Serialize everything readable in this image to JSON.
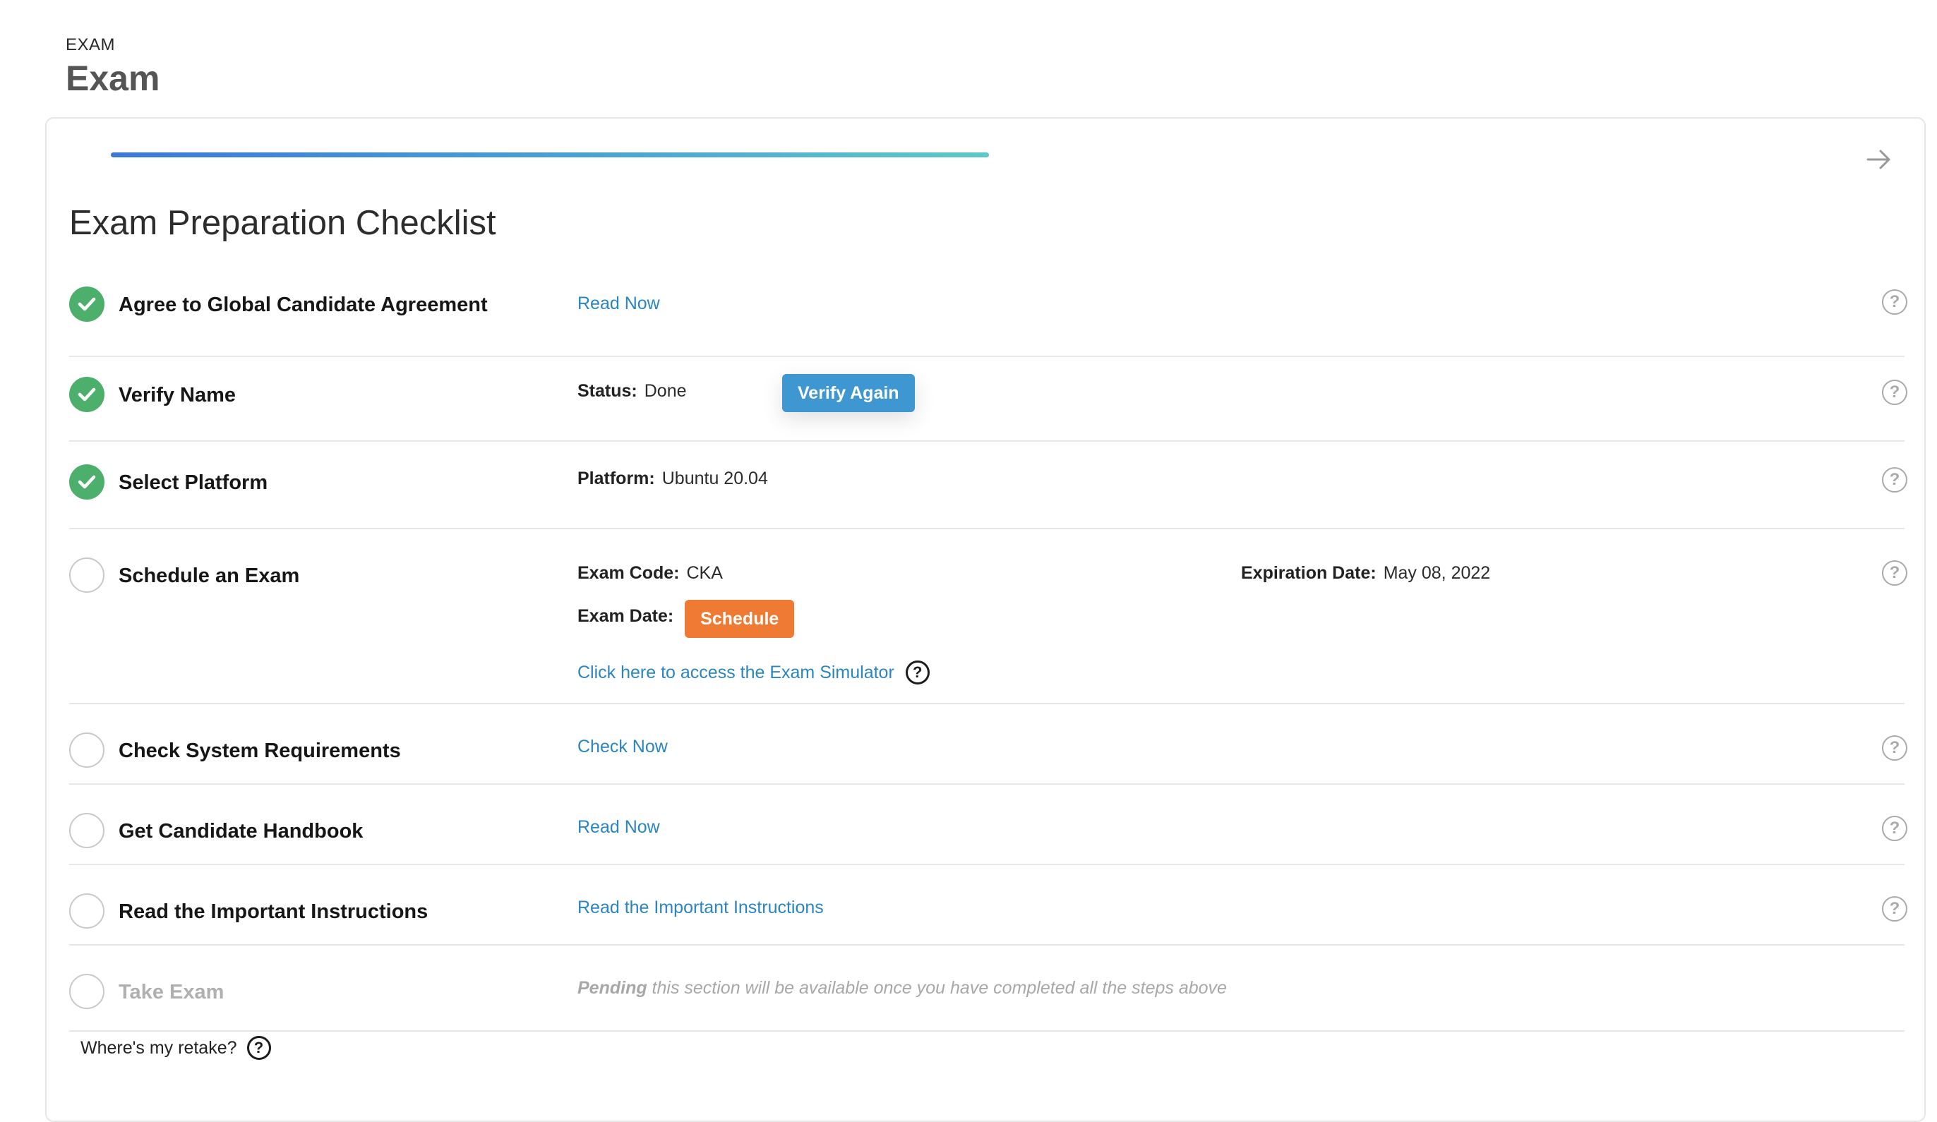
{
  "header": {
    "kicker": "EXAM",
    "title": "Exam"
  },
  "checklist_title": "Exam Preparation Checklist",
  "help_glyph": "?",
  "steps": [
    {
      "label": "Agree to Global Candidate Agreement",
      "done": true,
      "link": "Read Now"
    },
    {
      "label": "Verify Name",
      "done": true,
      "status_key": "Status:",
      "status_val": "Done",
      "button": "Verify Again"
    },
    {
      "label": "Select Platform",
      "done": true,
      "platform_key": "Platform:",
      "platform_val": "Ubuntu 20.04"
    },
    {
      "label": "Schedule an Exam",
      "done": false,
      "exam_code_key": "Exam Code:",
      "exam_code_val": "CKA",
      "expiration_key": "Expiration Date:",
      "expiration_val": "May 08, 2022",
      "exam_date_key": "Exam Date:",
      "schedule_button": "Schedule",
      "simulator_link": "Click here to access the Exam Simulator"
    },
    {
      "label": "Check System Requirements",
      "done": false,
      "link": "Check Now"
    },
    {
      "label": "Get Candidate Handbook",
      "done": false,
      "link": "Read Now"
    },
    {
      "label": "Read the Important Instructions",
      "done": false,
      "link": "Read the Important Instructions"
    },
    {
      "label": "Take Exam",
      "done": false,
      "disabled": true,
      "pending_bold": "Pending",
      "pending_text": " this section will be available once you have completed all the steps above"
    }
  ],
  "retake": "Where's my retake?",
  "colors": {
    "done_green": "#4caf6b",
    "link_blue": "#2a86c0",
    "verify_blue": "#3f97d1",
    "schedule_orange": "#ee7a33"
  },
  "icons": {
    "check": "check-icon",
    "help": "help-circle-icon",
    "next": "arrow-right-icon"
  }
}
